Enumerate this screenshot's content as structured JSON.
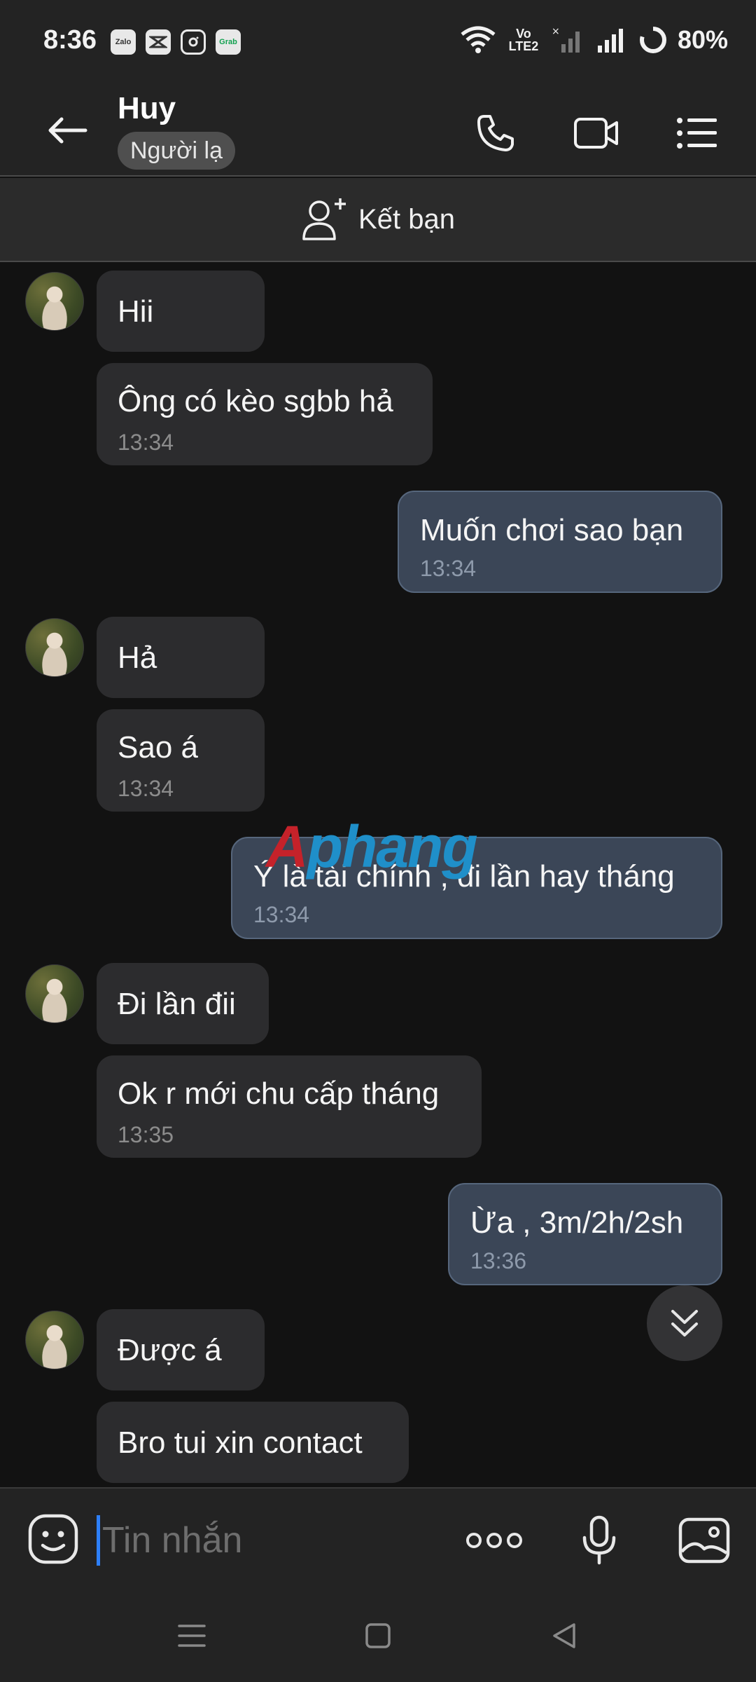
{
  "status_bar": {
    "time": "8:36",
    "notification_icons": [
      "Zalo",
      "CapCut",
      "Instagram",
      "Grab"
    ],
    "network": "Vo LTE2",
    "battery": "80%"
  },
  "header": {
    "contact_name": "Huy",
    "badge": "Người lạ"
  },
  "add_friend": {
    "label": "Kết bạn"
  },
  "messages": [
    {
      "side": "in",
      "text": "Hii",
      "time": ""
    },
    {
      "side": "in",
      "text": "Ông có kèo sgbb hả",
      "time": "13:34"
    },
    {
      "side": "out",
      "text": "Muốn chơi sao bạn",
      "time": "13:34"
    },
    {
      "side": "in",
      "text": "Hả",
      "time": ""
    },
    {
      "side": "in",
      "text": "Sao á",
      "time": "13:34"
    },
    {
      "side": "out",
      "text": "Ý là tài chính , đi lần hay tháng",
      "time": "13:34"
    },
    {
      "side": "in",
      "text": "Đi lần đii",
      "time": ""
    },
    {
      "side": "in",
      "text": "Ok r mới chu cấp tháng",
      "time": "13:35"
    },
    {
      "side": "out",
      "text": "Ừa , 3m/2h/2sh",
      "time": "13:36"
    },
    {
      "side": "in",
      "text": "Được á",
      "time": ""
    },
    {
      "side": "in",
      "text": "Bro tui xin contact",
      "time": ""
    }
  ],
  "watermark": {
    "first": "A",
    "rest": "phang"
  },
  "composer": {
    "placeholder": "Tin nhắn"
  },
  "colors": {
    "background": "#121212",
    "bar": "#232323",
    "incoming_bubble": "#2c2c2e",
    "outgoing_bubble": "#3b4657",
    "caret": "#2d7ff9"
  }
}
